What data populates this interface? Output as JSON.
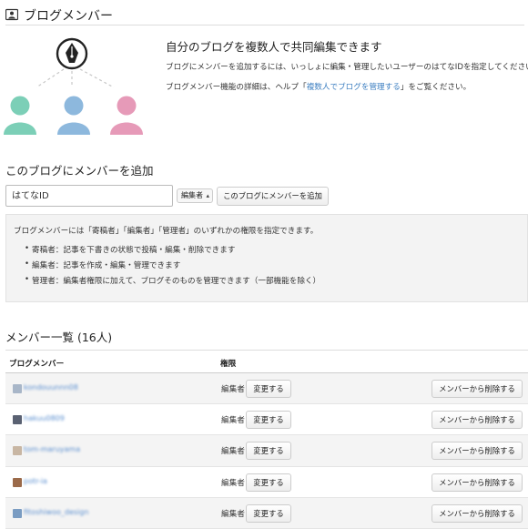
{
  "header": {
    "title": "ブログメンバー",
    "icon": "member-card-icon"
  },
  "intro": {
    "title": "自分のブログを複数人で共同編集できます",
    "line1": "ブログにメンバーを追加するには、いっしょに編集・管理したいユーザーのはてなIDを指定してください。",
    "line2_prefix": "ブログメンバー機能の詳細は、ヘルプ「",
    "line2_link": "複数人でブログを管理する",
    "line2_suffix": "」をご覧ください。",
    "illustration": "pen-nib-with-three-people-icon",
    "colors": {
      "person_left": "#7ccfb7",
      "person_center": "#8db8dd",
      "person_right": "#e69ab8",
      "nib": "#222222"
    }
  },
  "add": {
    "title": "このブログにメンバーを追加",
    "input_placeholder": "はてなID",
    "select_value": "編集者",
    "button_label": "このブログにメンバーを追加"
  },
  "info": {
    "lead": "ブログメンバーには「寄稿者」「編集者」「管理者」のいずれかの権限を指定できます。",
    "items": [
      "寄稿者：記事を下書きの状態で投稿・編集・削除できます",
      "編集者：記事を作成・編集・管理できます",
      "管理者：編集者権限に加えて、ブログそのものを管理できます（一部機能を除く）"
    ]
  },
  "members": {
    "title": "メンバー一覧 (16人)",
    "col_member": "ブログメンバー",
    "col_role": "権限",
    "change_label": "変更する",
    "remove_label": "メンバーから削除する",
    "link_color": "#3d7fc1",
    "rows": [
      {
        "name": "kondouunnn08",
        "role": "編集者",
        "avatar_color": "#a8b6c8"
      },
      {
        "name": "hakuu0809",
        "role": "編集者",
        "avatar_color": "#5a6172"
      },
      {
        "name": "tom-maruyama",
        "role": "編集者",
        "avatar_color": "#c8b6a3"
      },
      {
        "name": "potr-ia",
        "role": "編集者",
        "avatar_color": "#9b6a4a"
      },
      {
        "name": "fitoshiwoo_design",
        "role": "編集者",
        "avatar_color": "#7a9cc2"
      }
    ]
  }
}
